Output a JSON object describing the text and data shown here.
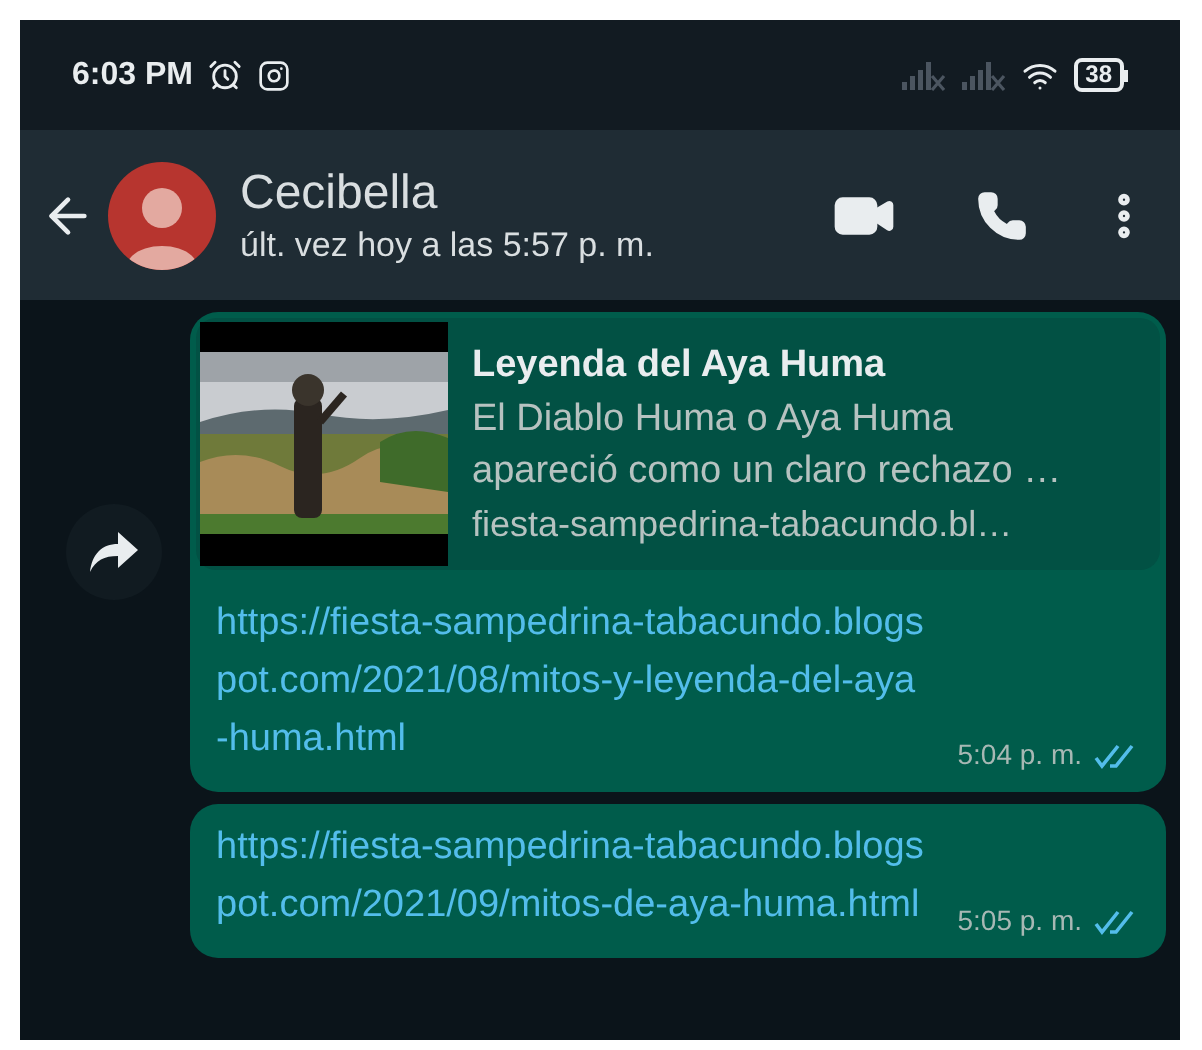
{
  "status_bar": {
    "time": "6:03 PM",
    "battery": "38"
  },
  "header": {
    "name": "Cecibella",
    "last_seen": "últ. vez hoy a las 5:57 p. m."
  },
  "messages": [
    {
      "kind": "link_preview",
      "forward_button": true,
      "preview": {
        "kind": "picture",
        "title": "Leyenda del Aya Huma",
        "description": "El Diablo Huma o Aya Huma apareció como un claro rechazo …",
        "domain": "fiesta-sampedrina-tabacundo.bl…"
      },
      "link": "https://fiesta-sampedrina-tabacundo.blogspot.com/2021/08/mitos-y-leyenda-del-aya-huma.html",
      "time": "5:04 p. m.",
      "read": true
    },
    {
      "kind": "link",
      "forward_button": false,
      "link": "https://fiesta-sampedrina-tabacundo.blogspot.com/2021/09/mitos-de-aya-huma.html",
      "time": "5:05 p. m.",
      "read": true
    }
  ]
}
